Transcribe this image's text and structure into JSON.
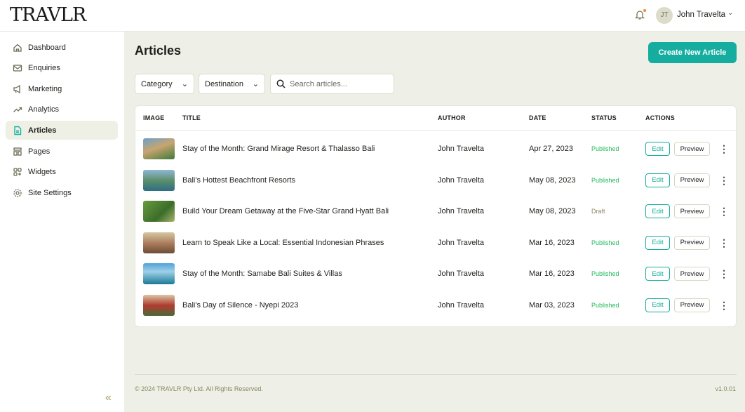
{
  "brand": "TRAVLR",
  "header": {
    "user_initials": "JT",
    "user_name": "John Travelta"
  },
  "sidebar": {
    "items": [
      {
        "label": "Dashboard",
        "icon": "home-icon"
      },
      {
        "label": "Enquiries",
        "icon": "mail-icon"
      },
      {
        "label": "Marketing",
        "icon": "megaphone-icon"
      },
      {
        "label": "Analytics",
        "icon": "trend-icon"
      },
      {
        "label": "Articles",
        "icon": "document-icon",
        "active": true
      },
      {
        "label": "Pages",
        "icon": "layout-icon"
      },
      {
        "label": "Widgets",
        "icon": "widgets-icon"
      },
      {
        "label": "Site Settings",
        "icon": "gear-icon"
      }
    ]
  },
  "page": {
    "title": "Articles",
    "create_label": "Create New Article"
  },
  "filters": {
    "category": "Category",
    "destination": "Destination",
    "search_placeholder": "Search articles..."
  },
  "table": {
    "headers": [
      "IMAGE",
      "TITLE",
      "AUTHOR",
      "DATE",
      "STATUS",
      "ACTIONS"
    ],
    "edit_label": "Edit",
    "preview_label": "Preview",
    "rows": [
      {
        "title": "Stay of the Month: Grand Mirage Resort & Thalasso Bali",
        "author": "John Travelta",
        "date": "Apr 27, 2023",
        "status": "Published"
      },
      {
        "title": "Bali's Hottest Beachfront Resorts",
        "author": "John Travelta",
        "date": "May 08, 2023",
        "status": "Published"
      },
      {
        "title": "Build Your Dream Getaway at the Five-Star Grand Hyatt Bali",
        "author": "John Travelta",
        "date": "May 08, 2023",
        "status": "Draft"
      },
      {
        "title": "Learn to Speak Like a Local: Essential Indonesian Phrases",
        "author": "John Travelta",
        "date": "Mar 16, 2023",
        "status": "Published"
      },
      {
        "title": "Stay of the Month: Samabe Bali Suites & Villas",
        "author": "John Travelta",
        "date": "Mar 16, 2023",
        "status": "Published"
      },
      {
        "title": "Bali's Day of Silence - Nyepi 2023",
        "author": "John Travelta",
        "date": "Mar 03, 2023",
        "status": "Published"
      }
    ]
  },
  "footer": {
    "copyright": "© 2024 TRAVLR Pty Ltd. All Rights Reserved.",
    "version": "v1.0.01"
  },
  "colors": {
    "accent": "#14ada0",
    "published": "#1fb95a",
    "draft": "#8a8763"
  }
}
